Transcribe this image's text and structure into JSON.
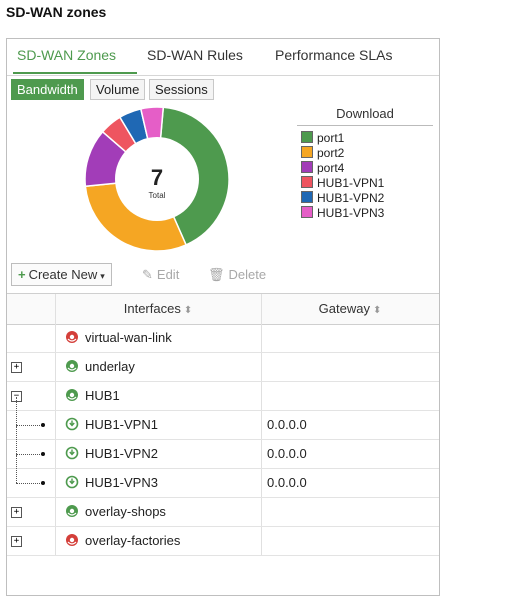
{
  "page": {
    "title": "SD-WAN zones"
  },
  "tabs": [
    {
      "label": "SD-WAN Zones",
      "active": true
    },
    {
      "label": "SD-WAN Rules",
      "active": false
    },
    {
      "label": "Performance SLAs",
      "active": false
    }
  ],
  "subtabs": [
    {
      "label": "Bandwidth",
      "active": true
    },
    {
      "label": "Volume",
      "active": false
    },
    {
      "label": "Sessions",
      "active": false
    }
  ],
  "chart_data": {
    "type": "pie",
    "center_value": "7",
    "center_label": "Total",
    "legend_title": "Download",
    "series": [
      {
        "name": "port1",
        "value": 42,
        "color": "#4e9a4e"
      },
      {
        "name": "port2",
        "value": 30,
        "color": "#f5a623"
      },
      {
        "name": "port4",
        "value": 13,
        "color": "#a23db8"
      },
      {
        "name": "HUB1-VPN1",
        "value": 5,
        "color": "#ee5560"
      },
      {
        "name": "HUB1-VPN2",
        "value": 5,
        "color": "#1f68b4"
      },
      {
        "name": "HUB1-VPN3",
        "value": 5,
        "color": "#e55ec7"
      }
    ],
    "legend_order": [
      "port1",
      "port2",
      "port4",
      "HUB1-VPN1",
      "HUB1-VPN2",
      "HUB1-VPN3"
    ],
    "draw_order": [
      "port1",
      "port2",
      "port4",
      "HUB1-VPN1",
      "HUB1-VPN2",
      "HUB1-VPN3"
    ]
  },
  "toolbar": {
    "create_label": "Create New",
    "edit_label": "Edit",
    "delete_label": "Delete"
  },
  "table": {
    "columns": [
      "Interfaces",
      "Gateway"
    ],
    "rows": [
      {
        "name": "virtual-wan-link",
        "gateway": "",
        "expander": "",
        "level": 0,
        "icon_color": "#d43f3a"
      },
      {
        "name": "underlay",
        "gateway": "",
        "expander": "+",
        "level": 0,
        "icon_color": "#4e9a4e"
      },
      {
        "name": "HUB1",
        "gateway": "",
        "expander": "−",
        "level": 0,
        "icon_color": "#4e9a4e"
      },
      {
        "name": "HUB1-VPN1",
        "gateway": "0.0.0.0",
        "expander": "",
        "level": 1,
        "icon_color": "#4e9a4e"
      },
      {
        "name": "HUB1-VPN2",
        "gateway": "0.0.0.0",
        "expander": "",
        "level": 1,
        "icon_color": "#4e9a4e"
      },
      {
        "name": "HUB1-VPN3",
        "gateway": "0.0.0.0",
        "expander": "",
        "level": 1,
        "icon_color": "#4e9a4e"
      },
      {
        "name": "overlay-shops",
        "gateway": "",
        "expander": "+",
        "level": 0,
        "icon_color": "#4e9a4e"
      },
      {
        "name": "overlay-factories",
        "gateway": "",
        "expander": "+",
        "level": 0,
        "icon_color": "#d43f3a"
      }
    ]
  }
}
